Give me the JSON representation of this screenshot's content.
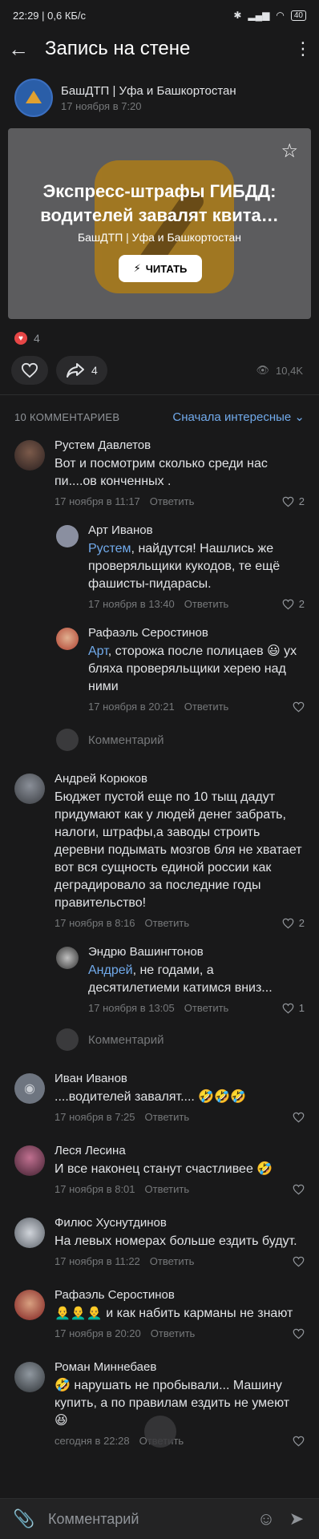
{
  "status": {
    "time": "22:29 | 0,6 КБ/с",
    "battery": "40"
  },
  "appbar": {
    "title": "Запись на стене"
  },
  "post": {
    "author": "БашДТП | Уфа и Башкортостан",
    "date": "17 ноября в 7:20",
    "card_title": "Экспресс-штрафы ГИБДД: водителей завалят квита…",
    "card_source": "БашДТП | Уфа и Башкортостан",
    "card_button": "ЧИТАТЬ",
    "likes": "4",
    "shares": "4",
    "views": "10,4K"
  },
  "comments_head": {
    "count": "10 КОММЕНТАРИЕВ",
    "sort": "Сначала интересные"
  },
  "comments": [
    {
      "name": "Рустем Давлетов",
      "text": "Вот и посмотрим сколько среди нас пи....ов конченных .",
      "date": "17 ноября в 11:17",
      "reply": "Ответить",
      "likes": "2"
    },
    {
      "name": "Арт Иванов",
      "mention": "Рустем",
      "text": ", найдутся! Нашлись же проверяльщики кукодов, те ещё фашисты-пидарасы.",
      "date": "17 ноября в 13:40",
      "reply": "Ответить",
      "likes": "2"
    },
    {
      "name": "Рафаэль Серостинов",
      "mention": "Арт",
      "text": ", сторожа после полицаев 😃 ух бляха проверяльщики херею над ними",
      "date": "17 ноября в 20:21",
      "reply": "Ответить",
      "likes": ""
    },
    {
      "name": "Андрей Корюков",
      "text": "Бюджет пустой еще по 10 тыщ дадут придумают как у людей денег забрать, налоги, штрафы,а заводы строить деревни подымать мозгов бля не хватает вот вся сущность единой россии как деградировало за последние годы правительство!",
      "date": "17 ноября в 8:16",
      "reply": "Ответить",
      "likes": "2"
    },
    {
      "name": "Эндрю Вашингтонов",
      "mention": "Андрей",
      "text": ", не годами, а десятилетиеми катимся вниз...",
      "date": "17 ноября в 13:05",
      "reply": "Ответить",
      "likes": "1"
    },
    {
      "name": "Иван Иванов",
      "text": "....водителей завалят.... 🤣🤣🤣",
      "date": "17 ноября в 7:25",
      "reply": "Ответить",
      "likes": ""
    },
    {
      "name": "Леся Лесина",
      "text": "И все наконец станут счастливее 🤣",
      "date": "17 ноября в 8:01",
      "reply": "Ответить",
      "likes": ""
    },
    {
      "name": "Филюс Хуснутдинов",
      "text": "На левых номерах больше ездить будут.",
      "date": "17 ноября в 11:22",
      "reply": "Ответить",
      "likes": ""
    },
    {
      "name": "Рафаэль Серостинов",
      "text": "👨‍🦲👨‍🦲👨‍🦲 и как набить карманы не знают",
      "date": "17 ноября в 20:20",
      "reply": "Ответить",
      "likes": ""
    },
    {
      "name": "Роман Миннебаев",
      "text": "🤣 нарушать не пробывали... Машину купить, а по правилам ездить не умеют 😆",
      "date": "сегодня в 22:28",
      "reply": "Ответить",
      "likes": ""
    }
  ],
  "write_reply": "Комментарий",
  "bottom": {
    "placeholder": "Комментарий"
  }
}
